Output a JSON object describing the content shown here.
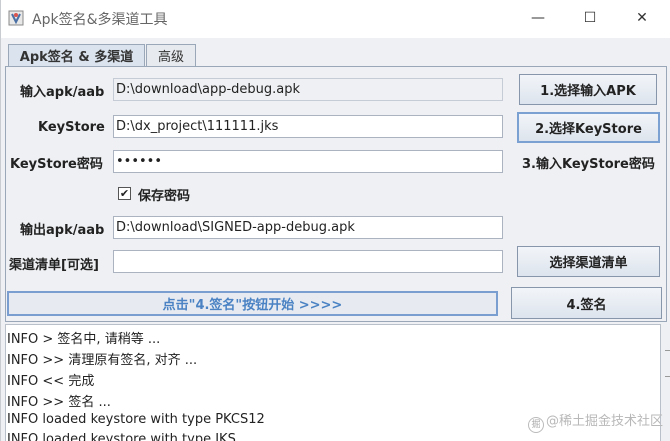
{
  "window": {
    "title": "Apk签名&多渠道工具",
    "controls": {
      "minimize": "—",
      "maximize": "☐",
      "close": "✕"
    }
  },
  "tabs": [
    {
      "label": "Apk签名 & 多渠道",
      "active": true
    },
    {
      "label": "高级",
      "active": false
    }
  ],
  "form": {
    "input_apk": {
      "label": "输入apk/aab",
      "value": "D:\\download\\app-debug.apk",
      "button": "1.选择输入APK"
    },
    "keystore": {
      "label": "KeyStore",
      "value": "D:\\dx_project\\111111.jks",
      "button": "2.选择KeyStore"
    },
    "keystore_password": {
      "label": "KeyStore密码",
      "value": "••••••",
      "hint": "3.输入KeyStore密码"
    },
    "save_password": {
      "label": "保存密码",
      "checked": true,
      "mark": "✔"
    },
    "output_apk": {
      "label": "输出apk/aab",
      "value": "D:\\download\\SIGNED-app-debug.apk"
    },
    "channel_list": {
      "label": "渠道清单[可选]",
      "value": "",
      "button": "选择渠道清单"
    }
  },
  "status": {
    "text": "点击\"4.签名\"按钮开始  >>>>"
  },
  "sign_button": "4.签名",
  "log": [
    "INFO > 签名中, 请稍等 ...",
    "INFO >> 清理原有签名, 对齐 ...",
    "INFO << 完成",
    "INFO >> 签名 ...",
    "INFO loaded keystore with type PKCS12",
    "INFO loaded keystore with type JKS"
  ],
  "watermark": "@稀土掘金技术社区",
  "colors": {
    "accent": "#4a82c4",
    "button_border": "#7aa1d2",
    "panel_bg": "#eef0f3"
  }
}
